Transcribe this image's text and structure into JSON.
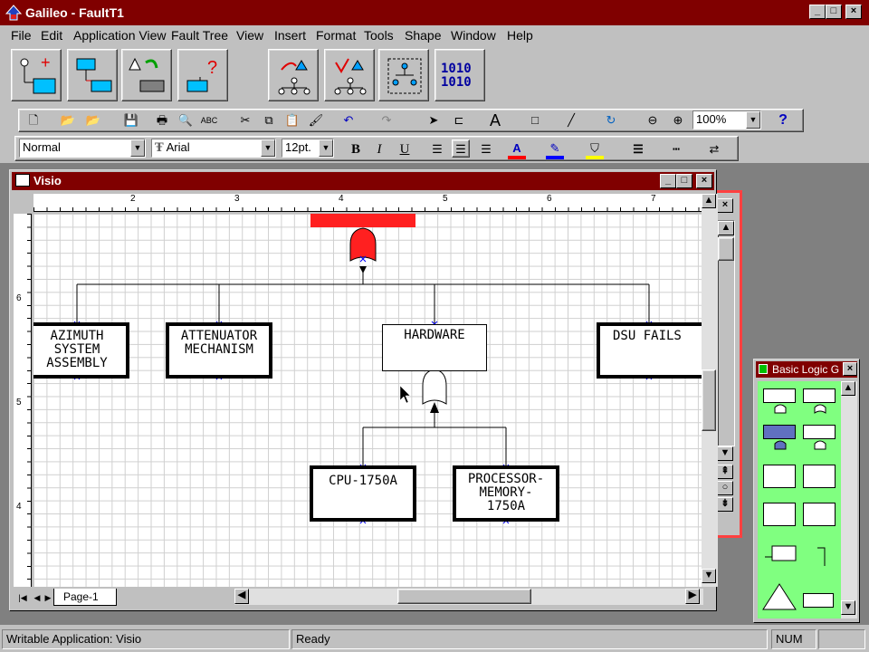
{
  "app": {
    "title": "Galileo - FaultT1"
  },
  "menu": [
    "File",
    "Edit",
    "Application View",
    "Fault Tree",
    "View",
    "Insert",
    "Format",
    "Tools",
    "Shape",
    "Window",
    "Help"
  ],
  "big_toolbar": {
    "binary_label": "1010\n1010"
  },
  "toolbar": {
    "zoom_value": "100%",
    "style_value": "Normal",
    "font_value": "Arial",
    "size_value": "12pt.",
    "bold": "B",
    "italic": "I",
    "underline": "U",
    "help": "?"
  },
  "visio": {
    "title": "Visio",
    "page_tab": "Page-1",
    "ruler_ticks": [
      "2",
      "3",
      "4",
      "5",
      "6",
      "7"
    ],
    "vruler_ticks": [
      "6",
      "5",
      "4"
    ]
  },
  "tree": {
    "nodes": {
      "azimuth": "AZIMUTH\nSYSTEM\nASSEMBLY",
      "attenuator": "ATTENUATOR\nMECHANISM",
      "hardware": "HARDWARE",
      "dsu": "DSU FAILS",
      "cpu": "CPU-1750A",
      "processor": "PROCESSOR-\nMEMORY-\n1750A"
    }
  },
  "stencil": {
    "title": "Basic Logic G"
  },
  "status": {
    "left": "Writable Application:  Visio",
    "middle": "Ready",
    "num": "NUM"
  },
  "colors": {
    "title_bar": "#800000",
    "gate_red": "#ff2020",
    "stencil_bg": "#80ff80",
    "shape_blue": "#0000ff"
  }
}
